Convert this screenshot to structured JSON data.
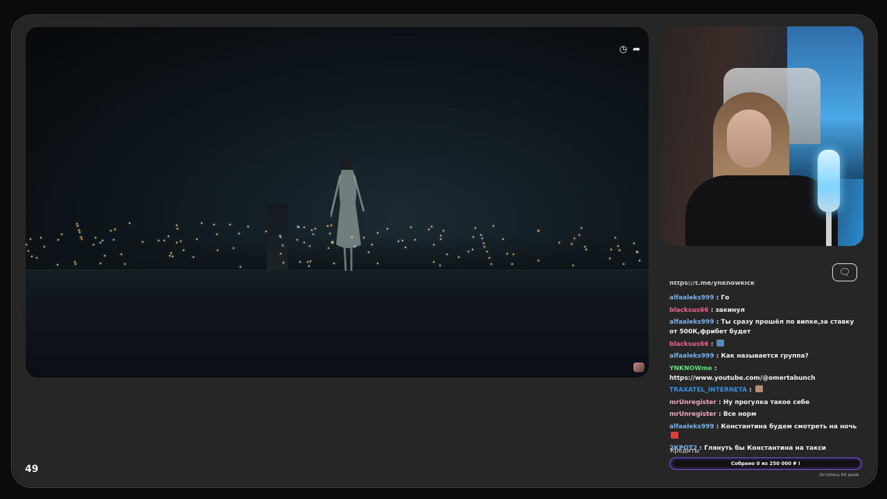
{
  "viewer_count": "49",
  "video": {
    "controls": {
      "clock_icon": "◷",
      "share_icon": "➦"
    }
  },
  "chat": {
    "icon": "🗨",
    "truncated_line": "https://t.me/ynknowkick",
    "messages": [
      {
        "user": "alfaaleks999",
        "color": "#79b3ee",
        "text": "Го"
      },
      {
        "user": "blacksus66",
        "color": "#f06292",
        "text": "закинул"
      },
      {
        "user": "alfaaleks999",
        "color": "#79b3ee",
        "text": "Ты сразу прошёл по випке,за ставку от 500К,фрибет будет"
      },
      {
        "user": "blacksus66",
        "color": "#f06292",
        "text": "",
        "emote_color": "#5a8ab8"
      },
      {
        "user": "alfaaleks999",
        "color": "#79b3ee",
        "text": "Как называется группа?"
      },
      {
        "user": "YNKNOWme",
        "color": "#5be37a",
        "text": "https://www.youtube.com/@omertabunch"
      },
      {
        "user": "TRAXATEL_INTERNETA",
        "color": "#3a8fe0",
        "text": "",
        "emote_color": "#b88b74"
      },
      {
        "user": "mrUnregister",
        "color": "#f2a8c0",
        "text": "Ну прогулка такое себе"
      },
      {
        "user": "mrUnregister",
        "color": "#f2a8c0",
        "text": "Все норм"
      },
      {
        "user": "alfaaleks999",
        "color": "#79b3ee",
        "text": "Константина будем смотреть на ночь",
        "emote_color": "#d84040"
      },
      {
        "user": "2КРОТ2",
        "color": "#79b3ee",
        "text": "Глянуть бы Константина на такси"
      }
    ],
    "credits": {
      "label": "Кредиты",
      "bar_text": "Собрано 0  из 250 000 ₽ !",
      "remaining": "Осталось 60 дней"
    }
  }
}
